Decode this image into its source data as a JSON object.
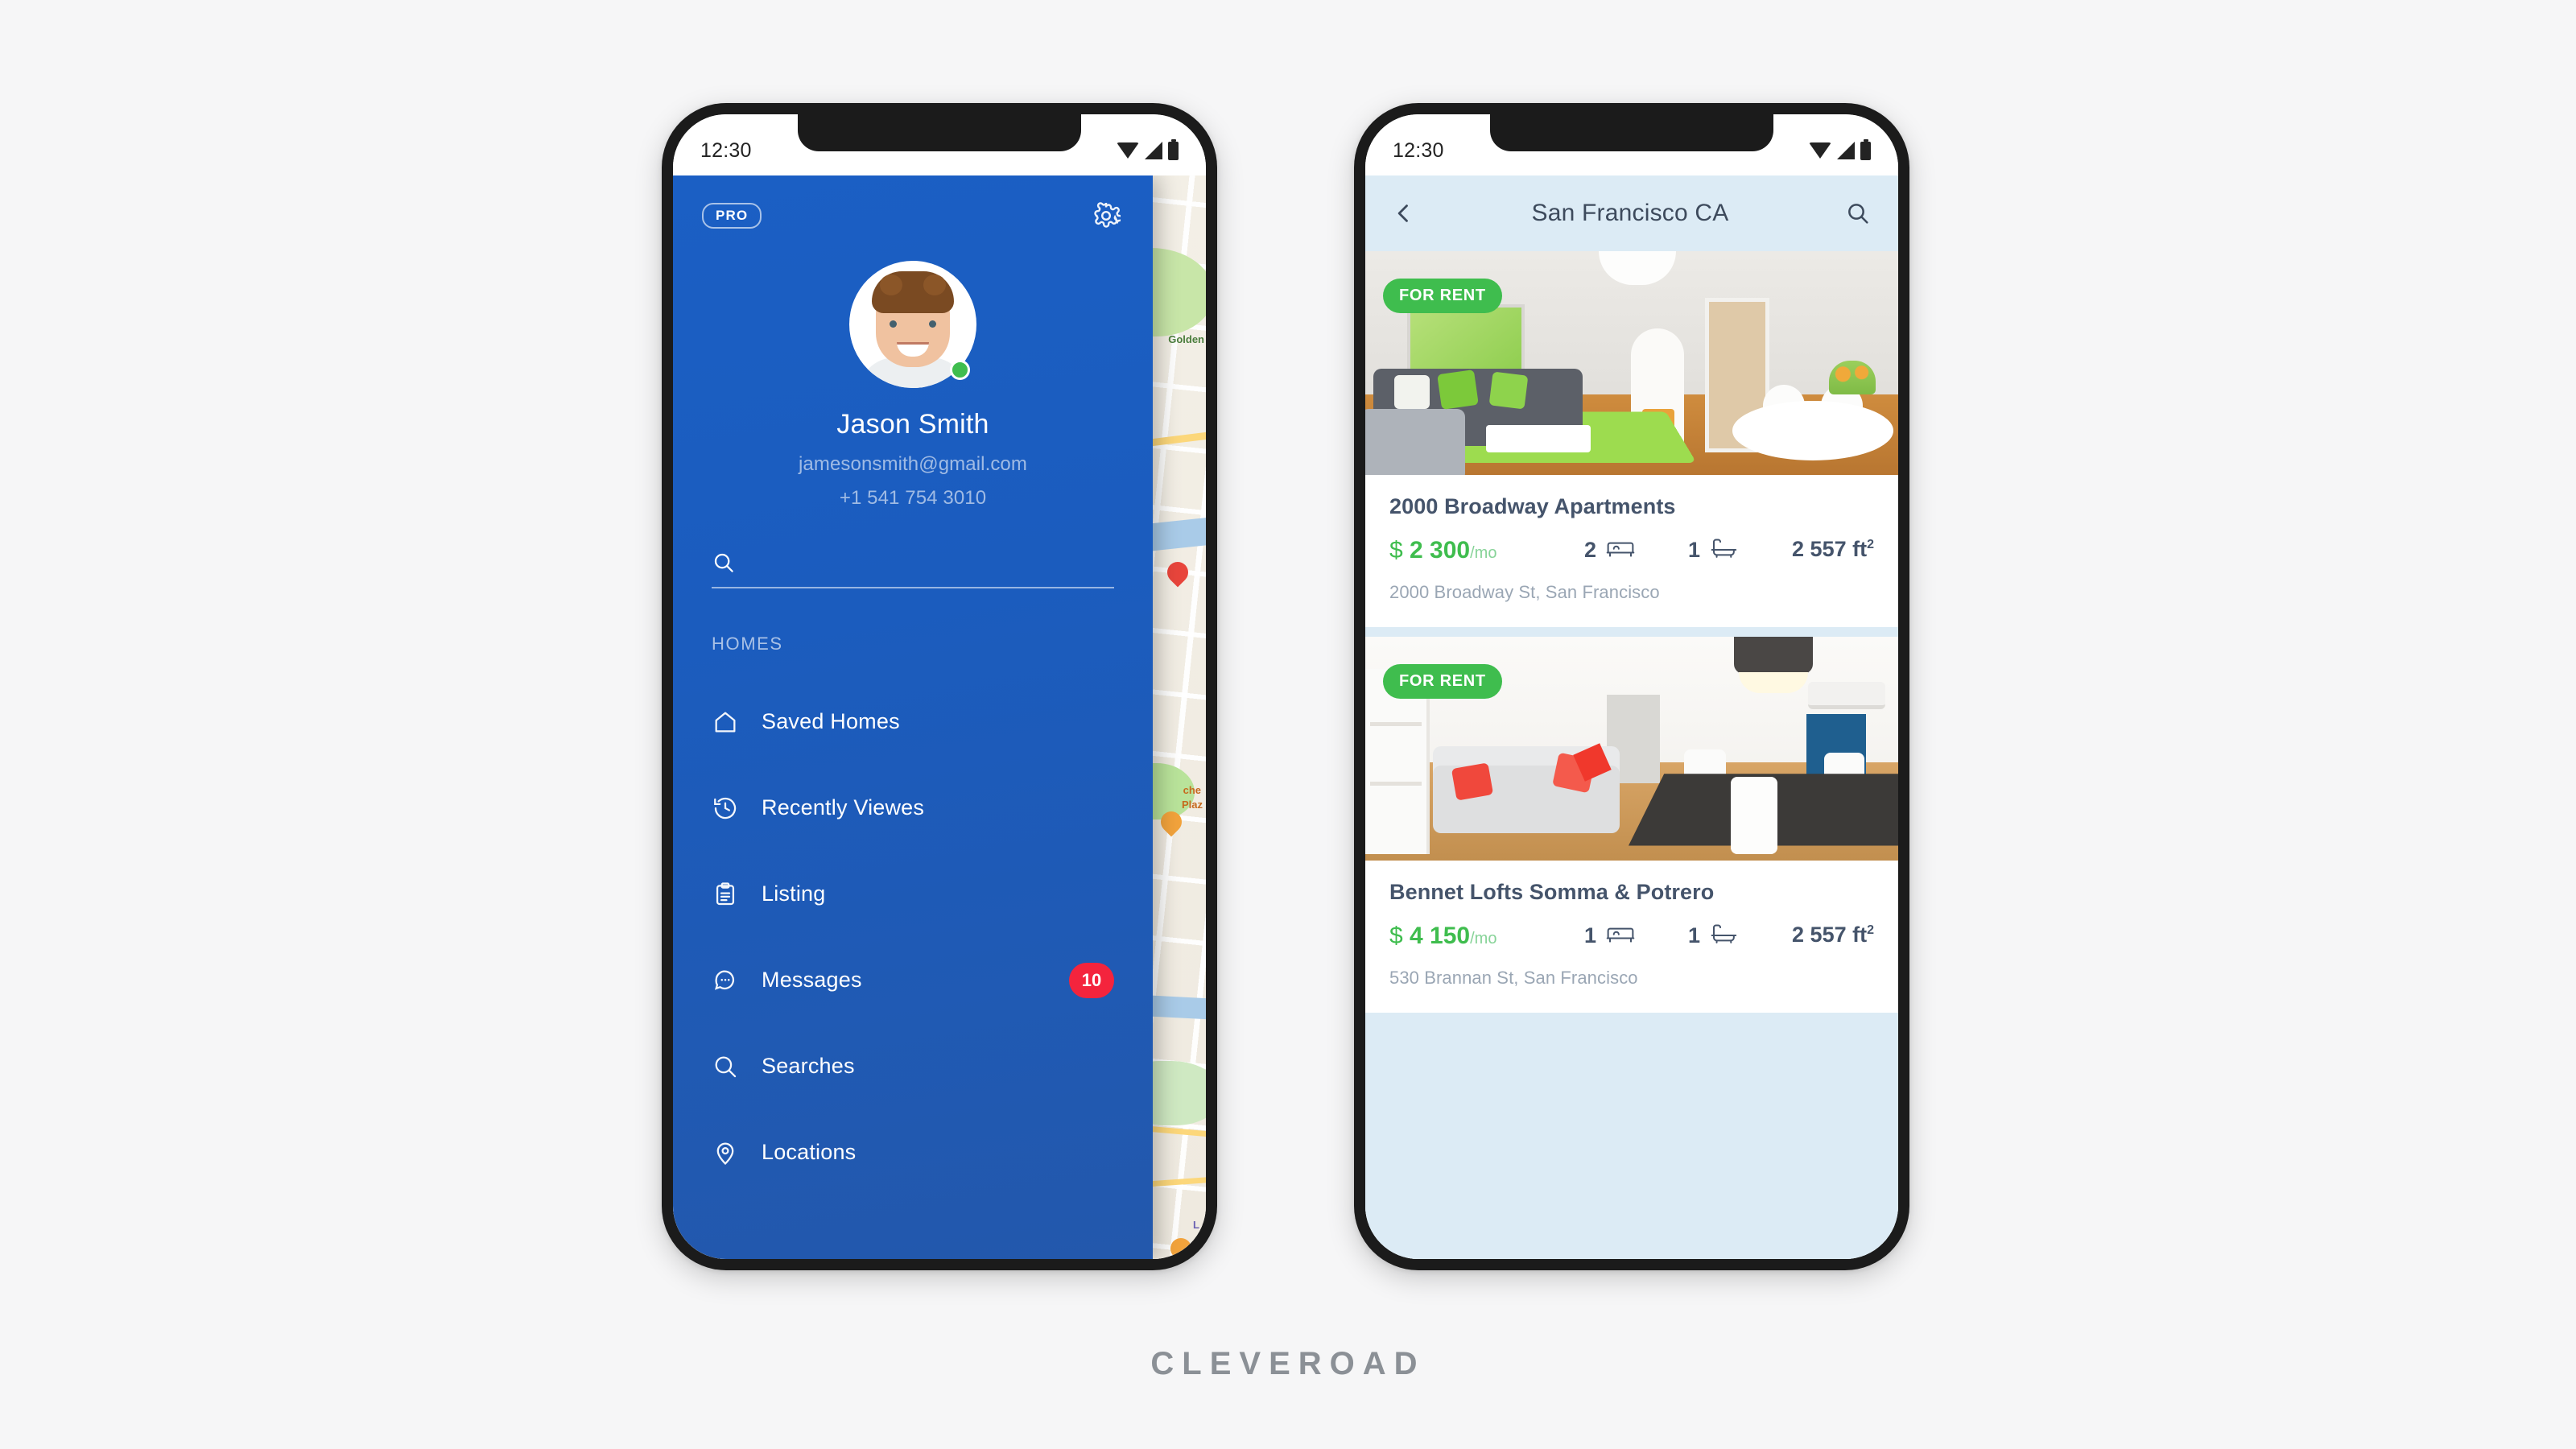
{
  "background_color": "#f6f6f7",
  "brand": {
    "logo_text": "CLEVEROAD",
    "primary_blue": "#1b5cbe",
    "accent_green": "#3fbd4e",
    "badge_red": "#f4243d"
  },
  "left_phone": {
    "status_bar": {
      "time": "12:30",
      "icons": [
        "wifi-icon",
        "signal-icon",
        "battery-icon"
      ]
    },
    "drawer": {
      "pro_badge": "PRO",
      "settings_icon": "gear-icon",
      "profile": {
        "avatar_icon": "avatar",
        "online_status": "online",
        "name": "Jason Smith",
        "email": "jamesonsmith@gmail.com",
        "phone": "+1 541 754 3010"
      },
      "search": {
        "icon": "search-icon",
        "value": "",
        "placeholder": ""
      },
      "section_label": "HOMES",
      "menu_items": [
        {
          "label": "Saved Homes",
          "icon": "home-icon",
          "badge": ""
        },
        {
          "label": "Recently Viewes",
          "icon": "history-icon",
          "badge": ""
        },
        {
          "label": "Listing",
          "icon": "clipboard-icon",
          "badge": ""
        },
        {
          "label": "Messages",
          "icon": "chat-icon",
          "badge": "10"
        },
        {
          "label": "Searches",
          "icon": "search-icon",
          "badge": ""
        },
        {
          "label": "Locations",
          "icon": "pin-icon",
          "badge": ""
        }
      ]
    },
    "map_labels": [
      "Golden",
      "che",
      "Plaz",
      "L"
    ]
  },
  "right_phone": {
    "status_bar": {
      "time": "12:30",
      "icons": [
        "wifi-icon",
        "signal-icon",
        "battery-icon"
      ]
    },
    "header": {
      "back_icon": "chevron-left-icon",
      "title": "San Francisco CA",
      "search_icon": "search-icon"
    },
    "listings": [
      {
        "badge": "FOR RENT",
        "title": "2000 Broadway Apartments",
        "currency": "$",
        "price": "2 300",
        "price_period": "/mo",
        "beds": "2",
        "beds_icon": "bed-icon",
        "baths": "1",
        "baths_icon": "bath-icon",
        "area": "2 557 ft",
        "area_exponent": "2",
        "address": "2000 Broadway St, San Francisco"
      },
      {
        "badge": "FOR RENT",
        "title": "Bennet Lofts Somma & Potrero",
        "currency": "$",
        "price": "4 150",
        "price_period": "/mo",
        "beds": "1",
        "beds_icon": "bed-icon",
        "baths": "1",
        "baths_icon": "bath-icon",
        "area": "2 557 ft",
        "area_exponent": "2",
        "address": "530 Brannan St, San Francisco"
      }
    ]
  }
}
